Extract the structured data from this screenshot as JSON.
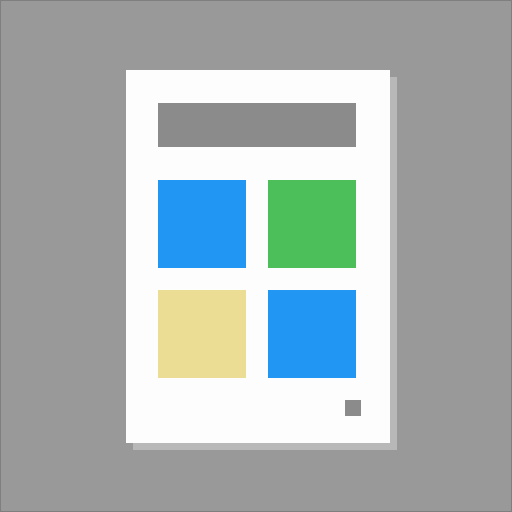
{
  "icon": {
    "name": "document-grid-icon",
    "colors": {
      "background": "#999999",
      "background_border": "#7f7f7f",
      "page": "#fdfdfd",
      "page_shadow": "#b8b8b8",
      "header_bar": "#8b8b8b",
      "tile_top_left": "#2196f3",
      "tile_top_right": "#4cbf5a",
      "tile_bottom_left": "#ecdd94",
      "tile_bottom_right": "#2196f3",
      "page_marker": "#8b8b8b"
    }
  }
}
